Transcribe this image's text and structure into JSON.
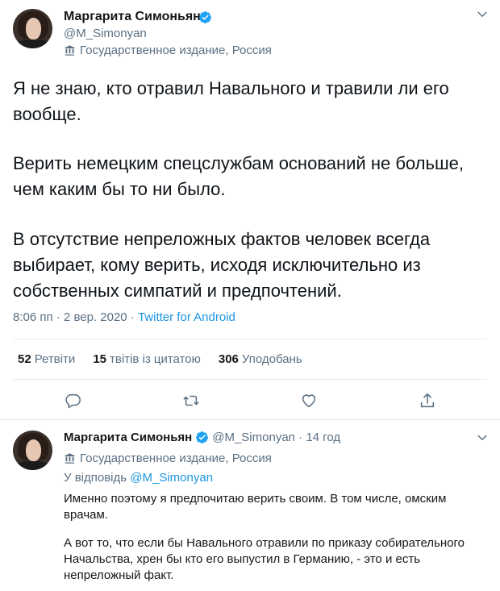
{
  "main_tweet": {
    "author_name": "Маргарита Симоньян",
    "handle": "@M_Simonyan",
    "label": "Государственное издание, Россия",
    "paragraphs": [
      "Я не знаю, кто отравил Навального и травили ли его вообще.",
      "Верить немецким спецслужбам оснований не больше, чем каким бы то ни было.",
      "В отсутствие непреложных фактов человек всегда выбирает, кому верить, исходя исключительно из собственных симпатий и предпочтений."
    ],
    "timestamp": "8:06 пп · 2 вер. 2020 · ",
    "source": "Twitter for Android",
    "stats": {
      "retweets_count": "52",
      "retweets_label": "Ретвіти",
      "quotes_count": "15",
      "quotes_label": "твітів із цитатою",
      "likes_count": "306",
      "likes_label": "Уподобань"
    }
  },
  "reply_tweet": {
    "author_name": "Маргарита Симоньян",
    "handle_time": "@M_Simonyan · 14 год",
    "label": "Государственное издание, Россия",
    "reply_prefix": "У відповідь ",
    "reply_mention": "@M_Simonyan",
    "paragraphs": [
      "Именно поэтому я предпочитаю верить своим. В том числе, омским врачам.",
      "А вот то, что если бы Навального отравили по приказу собирательного Начальства, хрен бы кто его выпустил в Германию, - это и есть непреложный факт."
    ]
  },
  "colors": {
    "accent": "#1da1f2",
    "link": "#1b95e0",
    "secondary_text": "#5b7083",
    "primary_text": "#0f1419"
  },
  "icons": [
    "verified-badge-icon",
    "chevron-down-icon",
    "flag-label-icon",
    "reply-icon",
    "retweet-icon",
    "like-icon",
    "share-icon"
  ]
}
